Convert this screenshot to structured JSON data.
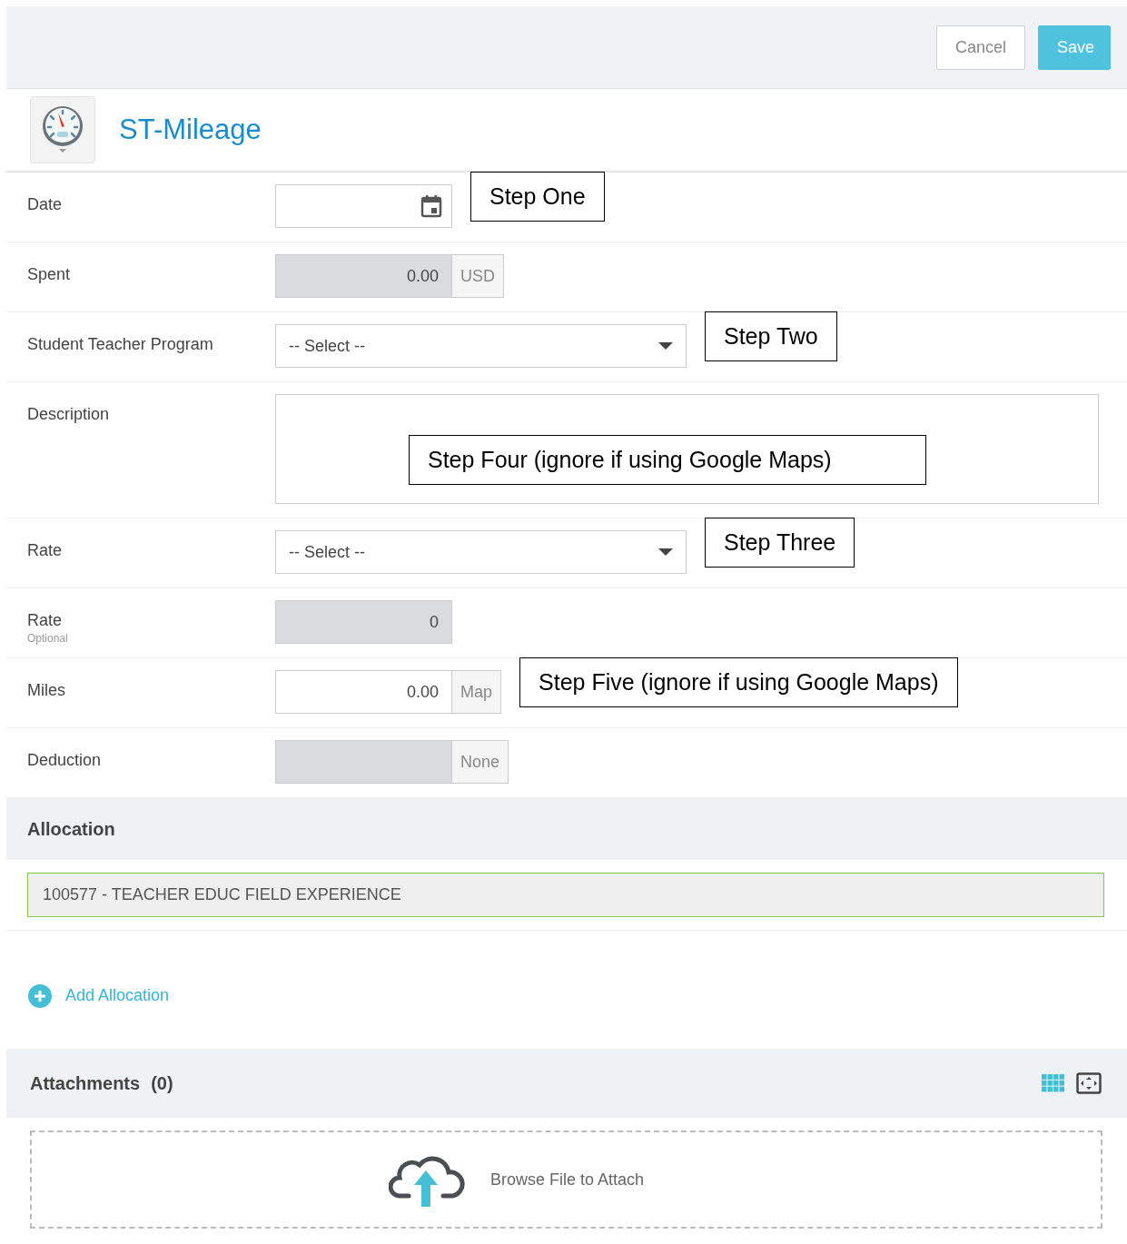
{
  "toolbar": {
    "buttons": [
      {
        "label": "Cancel",
        "kind": "secondary"
      },
      {
        "label": "Save",
        "kind": "primary"
      }
    ]
  },
  "form": {
    "title": "ST-Mileage",
    "rows": [
      {
        "label": "Date",
        "kind": "date",
        "callout": "Step One"
      },
      {
        "label": "Spent",
        "kind": "field",
        "readonly": true,
        "value": "0.00",
        "addon": "USD"
      },
      {
        "label": "Student Teacher Program",
        "kind": "select",
        "value": "-- Select --",
        "callout": "Step Two"
      },
      {
        "label": "Description",
        "kind": "textarea",
        "callout": "Step Four (ignore if using Google Maps)"
      },
      {
        "label": "Rate",
        "kind": "select",
        "value": "-- Select --",
        "callout": "Step Three"
      },
      {
        "label": "Rate",
        "note": "Optional",
        "kind": "field",
        "readonly": true,
        "value": "0"
      },
      {
        "label": "Miles",
        "kind": "field",
        "readonly": false,
        "value": "0.00",
        "addon": "Map",
        "callout": "Step Five (ignore if using Google Maps)"
      },
      {
        "label": "Deduction",
        "kind": "field",
        "readonly": true,
        "addon": "None"
      }
    ]
  },
  "allocation": {
    "title": "Allocation",
    "items": [
      "100577 - TEACHER EDUC FIELD EXPERIENCE"
    ],
    "add_label": "Add Allocation"
  },
  "attachments": {
    "title": "Attachments",
    "count": "(0)",
    "drop_label": "Browse File to Attach"
  }
}
